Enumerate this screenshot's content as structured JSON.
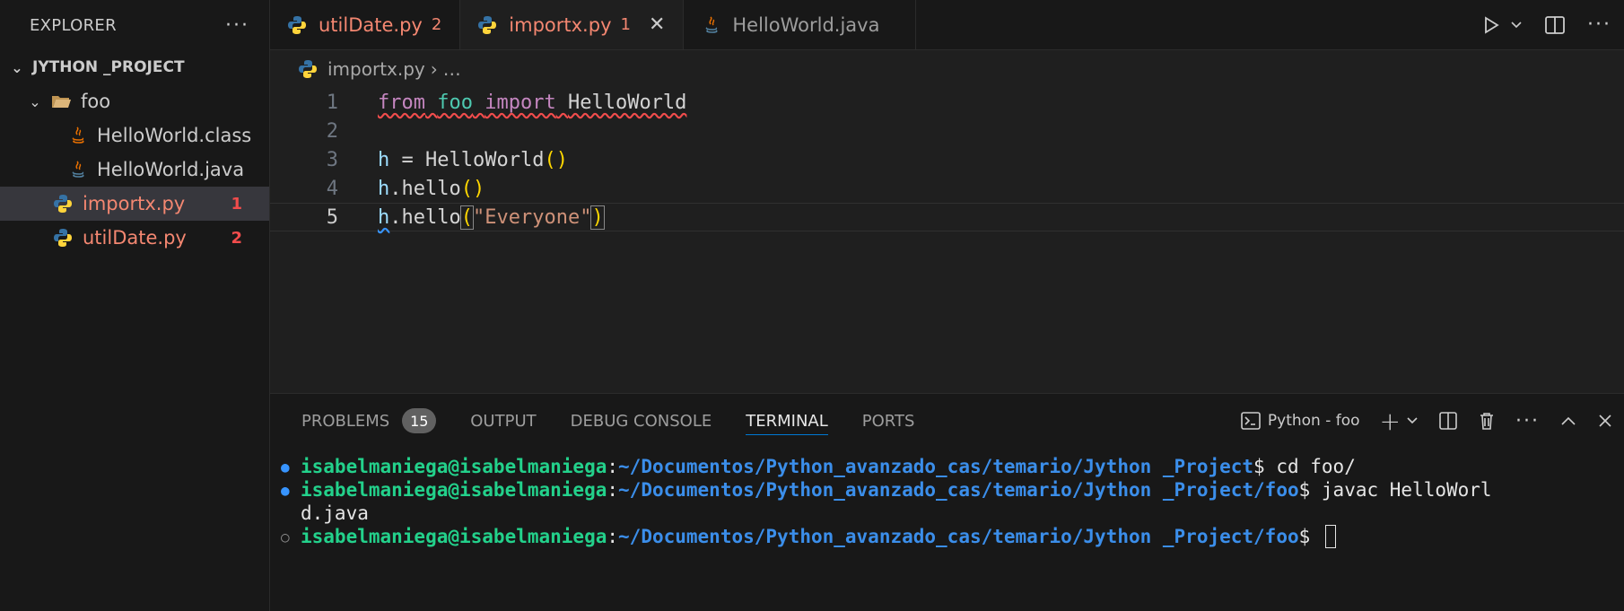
{
  "sidebar": {
    "title": "EXPLORER",
    "more": "···",
    "project": "JYTHON _PROJECT",
    "folder": "foo",
    "files": [
      {
        "name": "HelloWorld.class"
      },
      {
        "name": "HelloWorld.java"
      },
      {
        "name": "importx.py",
        "problems": "1"
      },
      {
        "name": "utilDate.py",
        "problems": "2"
      }
    ]
  },
  "tabs": [
    {
      "label": "utilDate.py",
      "problems": "2"
    },
    {
      "label": "importx.py",
      "problems": "1",
      "close": "✕"
    },
    {
      "label": "HelloWorld.java"
    }
  ],
  "breadcrumb": {
    "file": "importx.py",
    "sep": "›",
    "rest": "…"
  },
  "code": {
    "line_numbers": [
      "1",
      "2",
      "3",
      "4",
      "5"
    ],
    "l1": {
      "from": "from",
      "mod": "foo",
      "import": "import",
      "name": "HelloWorld"
    },
    "l3": {
      "var": "h",
      "eq": " = ",
      "call": "HelloWorld",
      "paren": "()"
    },
    "l4": {
      "var": "h",
      "call": ".hello",
      "paren": "()"
    },
    "l5": {
      "var": "h",
      "call": ".hello",
      "open": "(",
      "str": "\"Everyone\"",
      "close": ")"
    }
  },
  "panel": {
    "tabs": [
      "PROBLEMS",
      "OUTPUT",
      "DEBUG CONSOLE",
      "TERMINAL",
      "PORTS"
    ],
    "problems_count": "15",
    "terminal_name": "Python - foo"
  },
  "terminal": {
    "user": "isabelmaniega@isabelmaniega",
    "colon": ":",
    "lines": [
      {
        "path": "~/Documentos/Python_avanzado_cas/temario/Jython _Project",
        "cmd": "$ cd foo/"
      },
      {
        "path": "~/Documentos/Python_avanzado_cas/temario/Jython _Project/foo",
        "cmd": "$ javac HelloWorl"
      },
      {
        "wrap": "d.java"
      },
      {
        "path": "~/Documentos/Python_avanzado_cas/temario/Jython _Project/foo",
        "cmd": "$ "
      }
    ]
  }
}
